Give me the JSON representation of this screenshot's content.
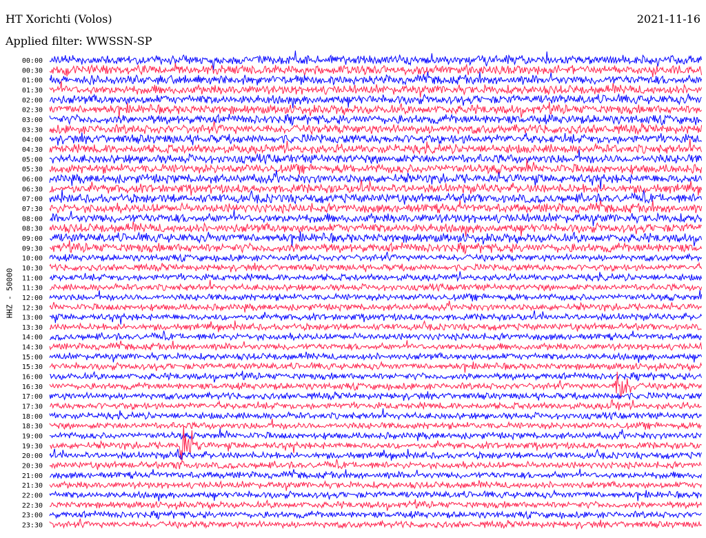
{
  "header": {
    "station": "HT Xorichti (Volos)",
    "date": "2021-11-16",
    "filter": "Applied filter: WWSSN-SP",
    "channel": "HHZ - 50000"
  },
  "colors": {
    "traceA": "#0000ff",
    "traceB": "#ff1f4a",
    "background": "#ffffff"
  },
  "chart_data": {
    "type": "line",
    "title": "HT Xorichti (Volos)",
    "subtitle": "Applied filter: WWSSN-SP",
    "ylabel": "HHZ - 50000",
    "rows": [
      "00:00",
      "00:30",
      "01:00",
      "01:30",
      "02:00",
      "02:30",
      "03:00",
      "03:30",
      "04:00",
      "04:30",
      "05:00",
      "05:30",
      "06:00",
      "06:30",
      "07:00",
      "07:30",
      "08:00",
      "08:30",
      "09:00",
      "09:30",
      "10:00",
      "10:30",
      "11:00",
      "11:30",
      "12:00",
      "12:30",
      "13:00",
      "13:30",
      "14:00",
      "14:30",
      "15:00",
      "15:30",
      "16:00",
      "16:30",
      "17:00",
      "17:30",
      "18:00",
      "18:30",
      "19:00",
      "19:30",
      "20:00",
      "20:30",
      "21:00",
      "21:30",
      "22:00",
      "22:30",
      "23:00",
      "23:30"
    ],
    "row_colors": "alternating blue/red",
    "events": [
      {
        "row": "16:30",
        "minute_in_row": 26,
        "label": ""
      },
      {
        "row": "19:30",
        "minute_in_row": 6,
        "label": ""
      }
    ]
  }
}
